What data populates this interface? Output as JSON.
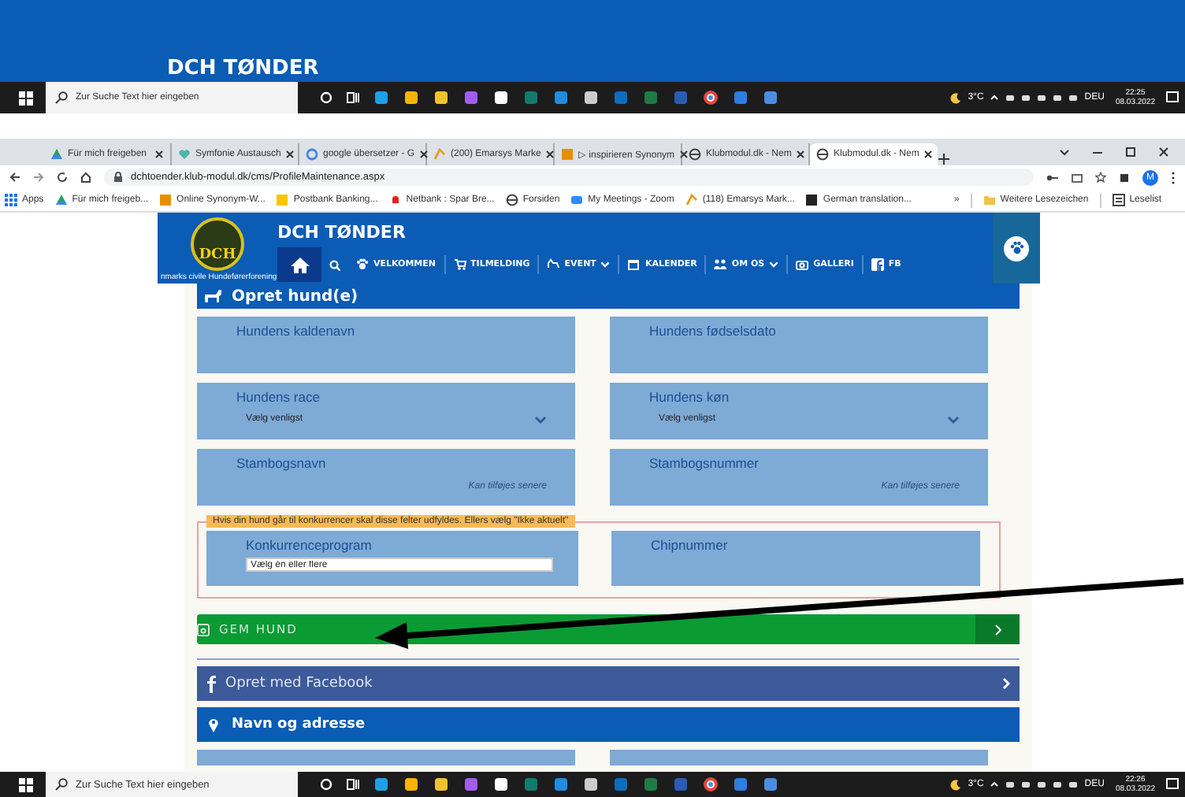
{
  "desktop_header": {
    "title": "DCH TØNDER"
  },
  "taskbar_top": {
    "search_placeholder": "Zur Suche Text hier eingeben",
    "weather": "3°C",
    "language": "DEU",
    "time": "22:25",
    "date": "08.03.2022"
  },
  "browser": {
    "tabs": [
      {
        "label": "Für mich freigeben",
        "selected": false
      },
      {
        "label": "Symfonie Austausch",
        "selected": false
      },
      {
        "label": "google übersetzer - G",
        "selected": false
      },
      {
        "label": "(200) Emarsys Marke",
        "selected": false
      },
      {
        "label": "▷ inspirieren Synonym",
        "selected": false
      },
      {
        "label": "Klubmodul.dk - Nem",
        "selected": false
      },
      {
        "label": "Klubmodul.dk - Nem",
        "selected": true
      }
    ],
    "url": "dchtoender.klub-modul.dk/cms/ProfileMaintenance.aspx",
    "profile_initial": "M",
    "bookmarks": [
      "Apps",
      "Für mich freigeb...",
      "Online Synonym-W...",
      "Postbank Banking...",
      "Netbank : Spar Bre...",
      "Forsiden",
      "My Meetings - Zoom",
      "(118) Emarsys Mark...",
      "German translation...",
      "»",
      "Weitere Lesezeichen",
      "Leselist"
    ]
  },
  "site": {
    "title": "DCH TØNDER",
    "logo_text": "DCH",
    "logo_caption": "nmarks civile Hundeførerforening",
    "nav": [
      {
        "label": "VELKOMMEN",
        "dropdown": false
      },
      {
        "label": "TILMELDING",
        "dropdown": false
      },
      {
        "label": "EVENT",
        "dropdown": true
      },
      {
        "label": "KALENDER",
        "dropdown": false
      },
      {
        "label": "OM OS",
        "dropdown": true
      },
      {
        "label": "GALLERI",
        "dropdown": false
      },
      {
        "label": "FB",
        "dropdown": false
      }
    ],
    "section": "Opret hund(e)",
    "fields": [
      {
        "kind": "text",
        "label": "Hundens kaldenavn"
      },
      {
        "kind": "text",
        "label": "Hundens fødselsdato"
      },
      {
        "kind": "select",
        "label": "Hundens race",
        "value": "Vælg venligst"
      },
      {
        "kind": "select",
        "label": "Hundens køn",
        "value": "Vælg venligst"
      },
      {
        "kind": "text",
        "label": "Stambogsnavn",
        "hint": "Kan tilføjes senere"
      },
      {
        "kind": "text",
        "label": "Stambogsnummer",
        "hint": "Kan tilføjes senere"
      }
    ],
    "competition": {
      "legend": "Hvis din hund går til konkurrencer skal disse felter udfyldes. Ellers vælg \"Ikke aktuelt\"",
      "fields": [
        {
          "kind": "multiselect",
          "label": "Konkurrenceprogram",
          "placeholder": "Vælg én eller flere"
        },
        {
          "kind": "text",
          "label": "Chipnummer"
        }
      ]
    },
    "save_button": "GEM HUND",
    "facebook_button": "Opret med Facebook",
    "address_section": "Navn og adresse"
  },
  "taskbar_bottom": {
    "search_placeholder": "Zur Suche Text hier eingeben",
    "weather": "3°C",
    "language": "DEU",
    "time": "22:26",
    "date": "08.03.2022"
  }
}
